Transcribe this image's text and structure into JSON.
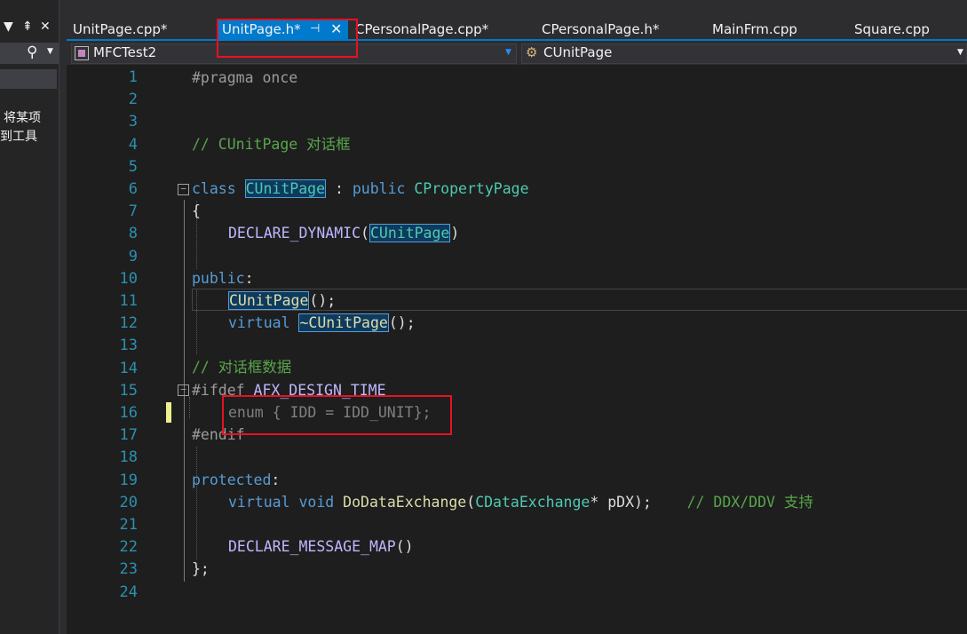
{
  "left_panel": {
    "dropdown_arrow": "▼",
    "pin": "⇞",
    "close": "✕",
    "search_icon": "search-icon",
    "text_line1": "将某项",
    "text_line2": "到工具"
  },
  "tabs": [
    {
      "label": "UnitPage.cpp*",
      "active": false
    },
    {
      "label": "UnitPage.h*",
      "active": true
    },
    {
      "label": "CPersonalPage.cpp*",
      "active": false
    },
    {
      "label": "CPersonalPage.h*",
      "active": false
    },
    {
      "label": "MainFrm.cpp",
      "active": false
    },
    {
      "label": "Square.cpp",
      "active": false
    }
  ],
  "active_tab_pin": "⊣",
  "active_tab_close": "✕",
  "nav": {
    "project": "MFCTest2",
    "scope": "CUnitPage"
  },
  "code": {
    "l1": "#pragma once",
    "l4": "// CUnitPage 对话框",
    "l6_kw": "class",
    "l6_name": "CUnitPage",
    "l6_mid": " : ",
    "l6_pub": "public",
    "l6_base": " CPropertyPage",
    "l7": "{",
    "l8_macro": "DECLARE_DYNAMIC",
    "l8_paren_open": "(",
    "l8_arg": "CUnitPage",
    "l8_paren_close": ")",
    "l10_kw": "public",
    "l10_colon": ":",
    "l11_name": "CUnitPage",
    "l11_rest": "();",
    "l12_kw": "virtual",
    "l12_name": "~CUnitPage",
    "l12_rest": "();",
    "l14": "// 对话框数据",
    "l15_kw": "#ifdef",
    "l15_macro": " AFX_DESIGN_TIME",
    "l16": "enum { IDD = IDD_UNIT};",
    "l17": "#endif",
    "l19_kw": "protected",
    "l19_colon": ":",
    "l20_kw": "virtual",
    "l20_void": "void",
    "l20_fn": "DoDataExchange",
    "l20_open": "(",
    "l20_type": "CDataExchange",
    "l20_ptr": "* pDX);",
    "l20_cm": "// DDX/DDV 支持",
    "l22_macro": "DECLARE_MESSAGE_MAP",
    "l22_rest": "()",
    "l23": "};",
    "line_numbers": [
      "1",
      "2",
      "3",
      "4",
      "5",
      "6",
      "7",
      "8",
      "9",
      "10",
      "11",
      "12",
      "13",
      "14",
      "15",
      "16",
      "17",
      "18",
      "19",
      "20",
      "21",
      "22",
      "23",
      "24"
    ]
  },
  "colors": {
    "accent": "#007acc",
    "annotation_red": "#e81123",
    "keyword": "#569cd6",
    "comment": "#57a64a",
    "type": "#4ec9b0"
  }
}
